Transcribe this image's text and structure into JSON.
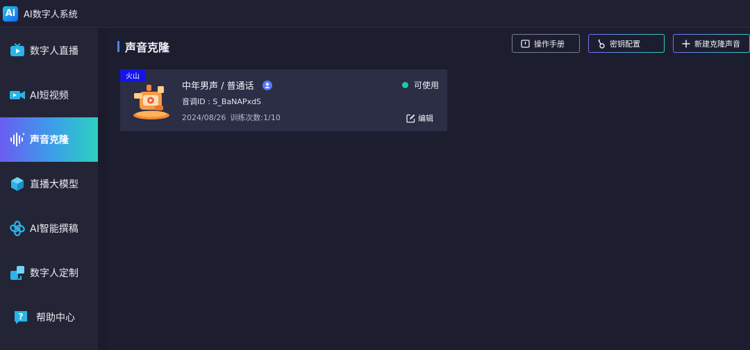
{
  "app": {
    "logo_text": "Ai",
    "title": "AI数字人系统"
  },
  "sidebar": {
    "items": [
      {
        "label": "数字人直播",
        "icon": "tv-play-icon",
        "active": false
      },
      {
        "label": "AI短视频",
        "icon": "video-camera-icon",
        "active": false
      },
      {
        "label": "声音克隆",
        "icon": "waveform-icon",
        "active": true
      },
      {
        "label": "直播大模型",
        "icon": "cube-icon",
        "active": false
      },
      {
        "label": "AI智能撰稿",
        "icon": "openai-knot-icon",
        "active": false
      },
      {
        "label": "数字人定制",
        "icon": "customize-squares-icon",
        "active": false
      },
      {
        "label": "帮助中心",
        "icon": "help-question-icon",
        "active": false
      }
    ]
  },
  "page": {
    "title": "声音克隆"
  },
  "actions": {
    "manual_label": "操作手册",
    "key_label": "密钥配置",
    "new_label": "新建克隆声音"
  },
  "voices": [
    {
      "tag": "火山",
      "name": "中年男声 / 普通话",
      "id_label": "音调ID : S_BaNAPxdS",
      "date": "2024/08/26",
      "train_label": "训练次数:1/10",
      "status": "可使用",
      "edit_label": "编辑"
    }
  ],
  "colors": {
    "accent": "#3f8cff",
    "status_ok": "#20c9a6",
    "tag_bg": "#1414e6",
    "active_gradient_start": "#6a5cf2",
    "active_gradient_end": "#2ed0c0"
  }
}
